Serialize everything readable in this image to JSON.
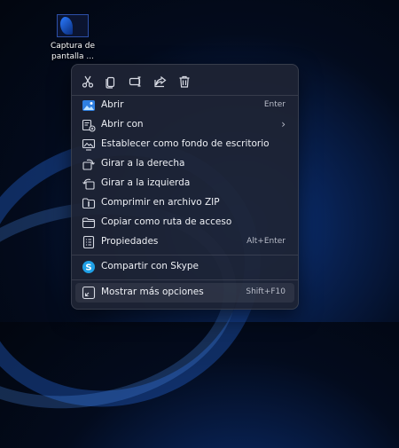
{
  "desktop": {
    "icon_label_line1": "Captura de",
    "icon_label_line2": "pantalla ..."
  },
  "toolbar": {
    "icons": [
      "cut-icon",
      "copy-icon",
      "rename-icon",
      "share-icon",
      "delete-icon"
    ]
  },
  "menu": {
    "items": [
      {
        "label": "Abrir",
        "shortcut": "Enter"
      },
      {
        "label": "Abrir con",
        "shortcut": "›"
      },
      {
        "label": "Establecer como fondo de escritorio",
        "shortcut": ""
      },
      {
        "label": "Girar a la derecha",
        "shortcut": ""
      },
      {
        "label": "Girar a la izquierda",
        "shortcut": ""
      },
      {
        "label": "Comprimir en archivo ZIP",
        "shortcut": ""
      },
      {
        "label": "Copiar como ruta de acceso",
        "shortcut": ""
      },
      {
        "label": "Propiedades",
        "shortcut": "Alt+Enter"
      },
      {
        "label": "Compartir con Skype",
        "shortcut": ""
      },
      {
        "label": "Mostrar más opciones",
        "shortcut": "Shift+F10"
      }
    ]
  },
  "colors": {
    "accent": "#4aa3ff",
    "skype": "#1fa0e6"
  }
}
